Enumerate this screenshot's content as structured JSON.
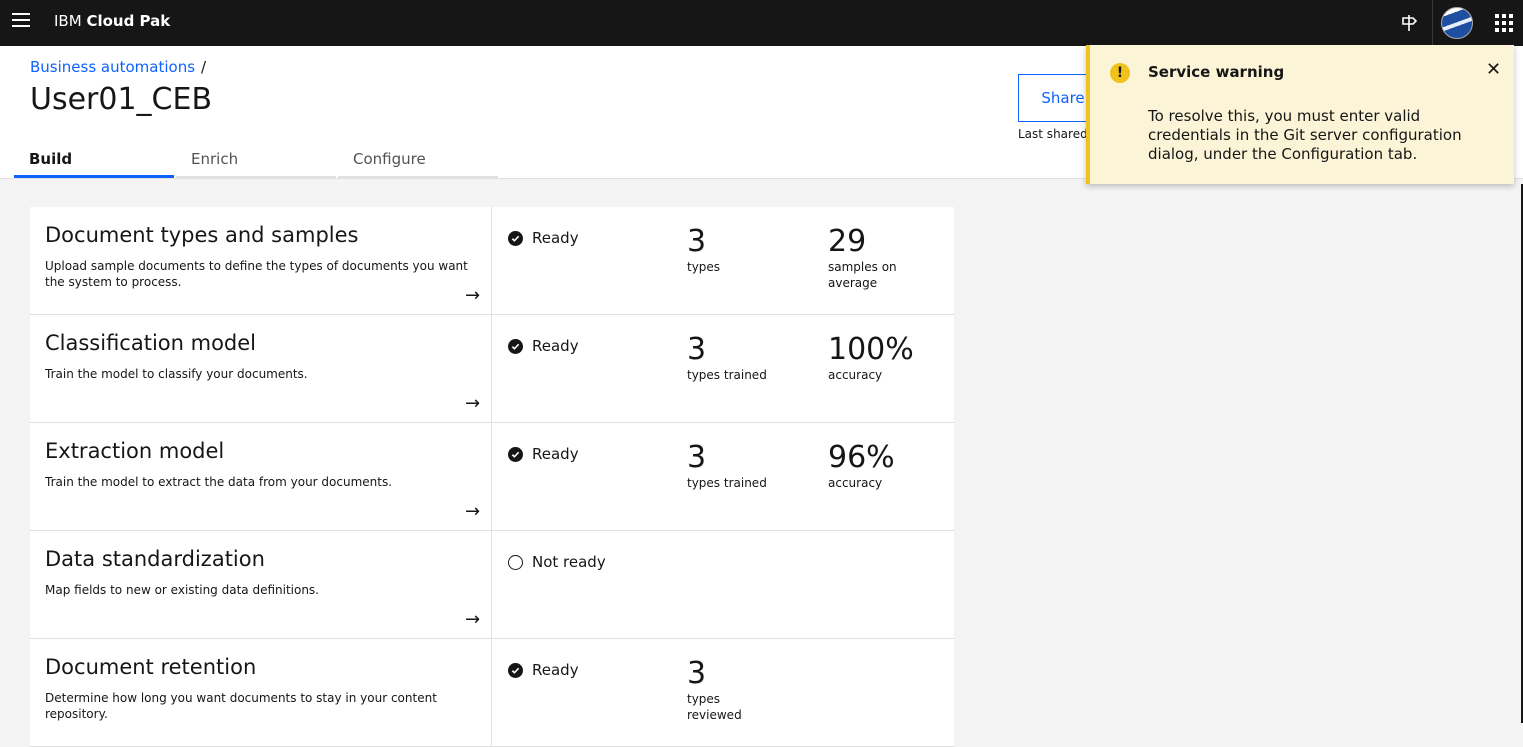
{
  "topbar": {
    "brand_prefix": "IBM",
    "brand_name": "Cloud Pak"
  },
  "header": {
    "breadcrumb": "Business automations",
    "breadcrumb_sep": "/",
    "title": "User01_CEB",
    "share_label": "Share",
    "last_shared": "Last shared"
  },
  "tabs": [
    {
      "label": "Build"
    },
    {
      "label": "Enrich"
    },
    {
      "label": "Configure"
    }
  ],
  "cards": [
    {
      "title": "Document types and samples",
      "desc": "Upload sample documents to define the types of documents you want the system to process.",
      "status": "Ready",
      "m1_num": "3",
      "m1_label": "types",
      "m2_num": "29",
      "m2_label": "samples on average"
    },
    {
      "title": "Classification model",
      "desc": "Train the model to classify your documents.",
      "status": "Ready",
      "m1_num": "3",
      "m1_label": "types trained",
      "m2_num": "100%",
      "m2_label": "accuracy"
    },
    {
      "title": "Extraction model",
      "desc": "Train the model to extract the data from your documents.",
      "status": "Ready",
      "m1_num": "3",
      "m1_label": "types trained",
      "m2_num": "96%",
      "m2_label": "accuracy"
    },
    {
      "title": "Data standardization",
      "desc": "Map fields to new or existing data definitions.",
      "status": "Not ready",
      "m1_num": "",
      "m1_label": "",
      "m2_num": "",
      "m2_label": ""
    },
    {
      "title": "Document retention",
      "desc": "Determine how long you want documents to stay in your content repository.",
      "status": "Ready",
      "m1_num": "3",
      "m1_label": "types reviewed",
      "m2_num": "",
      "m2_label": ""
    }
  ],
  "toast": {
    "title": "Service warning",
    "message": "To resolve this, you must enter valid credentials in the Git server configuration dialog, under the Configuration tab."
  },
  "colors": {
    "accent": "#0f62fe",
    "warning": "#f1c21b",
    "topbar": "#161616"
  },
  "icons": [
    "menu-icon",
    "launch-icon",
    "avatar",
    "app-switcher-icon",
    "arrow-right-icon",
    "checkmark-icon",
    "warning-icon",
    "close-icon"
  ]
}
